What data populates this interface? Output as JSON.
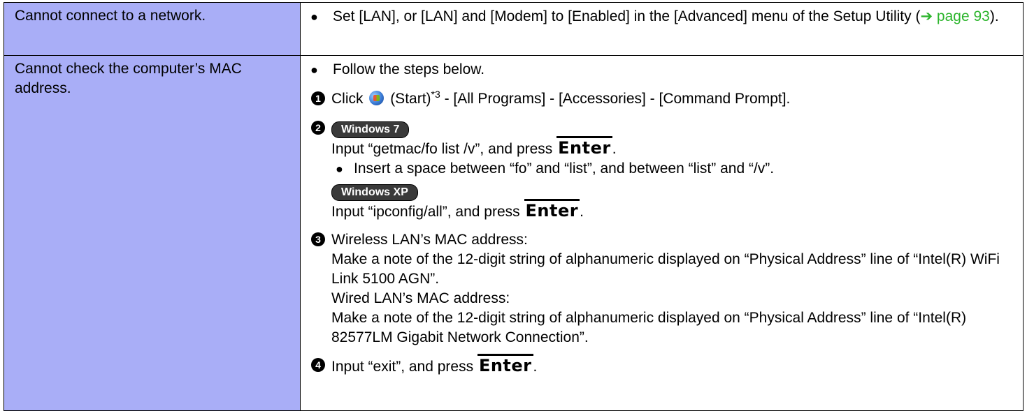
{
  "rows": [
    {
      "problem": "Cannot connect to a network.",
      "solution": {
        "bullet_prefix": "Set [LAN], or [LAN] and [Modem] to [Enabled] in the [Advanced] menu of the Setup Utility (",
        "link_arrow": "➔",
        "link_text": "page 93",
        "bullet_suffix": ")."
      }
    },
    {
      "problem": "Cannot check the computer’s MAC address.",
      "solution": {
        "intro": "Follow the steps below.",
        "step1": {
          "before_icon": "Click",
          "start_label": "(Start)",
          "footnote": "*3",
          "after": " - [All Programs] - [Accessories] - [Command Prompt]."
        },
        "step2": {
          "os1": "Windows 7",
          "os1_text_before": "Input “getmac/fo list /v”, and press",
          "key": "Enter",
          "period": ".",
          "os1_note": "Insert a space between “fo” and “list”, and between “list” and “/v”.",
          "os2": "Windows XP",
          "os2_text_before": "Input “ipconfig/all”, and press"
        },
        "step3": {
          "line1": "Wireless LAN’s MAC address:",
          "line2": "Make a note of the 12-digit string of alphanumeric displayed on “Physical Address” line of “Intel(R) WiFi Link 5100 AGN”.",
          "line3": "Wired LAN’s MAC address:",
          "line4": "Make a note of the 12-digit string of alphanumeric displayed on “Physical Address” line of “Intel(R) 82577LM Gigabit Network Connection”."
        },
        "step4": {
          "text_before": "Input “exit”, and press"
        }
      }
    }
  ],
  "step_numbers": [
    "1",
    "2",
    "3",
    "4"
  ],
  "colors": {
    "problem_bg": "#a9aef7",
    "link": "#2db52d"
  }
}
